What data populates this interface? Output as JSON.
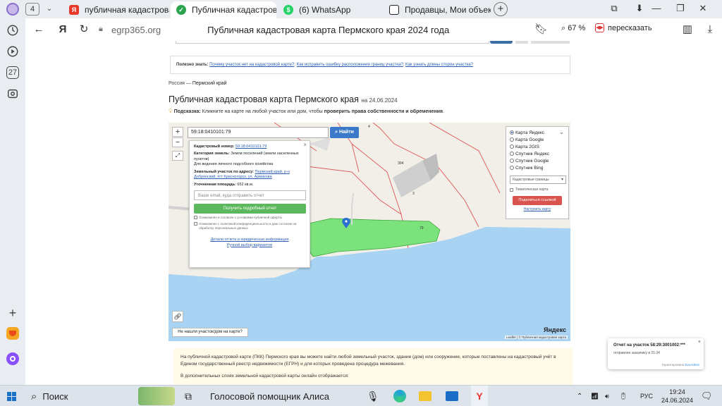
{
  "tabs": {
    "count": "4",
    "items": [
      {
        "title": "публичная кадастровая к",
        "fav_color": "#e8382a",
        "fav_glyph": "Я"
      },
      {
        "title": "Публичная кадастрова",
        "fav_color": "#2ca44e",
        "fav_glyph": "✓"
      },
      {
        "title": "(6) WhatsApp",
        "fav_color": "#25d366",
        "fav_glyph": "●"
      },
      {
        "title": "Продавцы, Мои объекты",
        "fav_color": "#222222",
        "fav_glyph": "▣"
      }
    ]
  },
  "sidebar": {
    "badge": "27"
  },
  "address": {
    "host": "egrp365.org",
    "title": "Публичная кадастровая карта Пермского края 2024 года",
    "zoom": "67 %",
    "retell": "пересказать"
  },
  "page": {
    "useful_label": "Полезно знать:",
    "useful_links": [
      "Почему участок нет на кадастровой карте?",
      "Как исправить ошибку расположения границ участка?",
      "Как узнать длины сторон участка?"
    ],
    "breadcrumb_root": "Россия",
    "breadcrumb_sep": "—",
    "breadcrumb_current": "Пермский край",
    "heading": "Публичная кадастровая карта Пермского края",
    "heading_date": "на 24.06.2024",
    "hint_label": "Подсказка:",
    "hint_text": "Кликните на карте на любой участок или дом, чтобы",
    "hint_bold": "проверить права собственности и обременения",
    "desc_1": "На публичной кадастровой карте (ПКК) Пермского края вы можете найти любой земельный участок, здание (дом) или сооружение, которые поставлены на кадастровый учёт в Едином государственный реестр недвижимости (ЕГРН) и для которых проведена процедура межевания.",
    "desc_2": "В дополнительных слоях земельной кадастровой карты онлайн отображается:"
  },
  "map": {
    "search_value": "59:18:0410101:79",
    "find_button": "Найти",
    "labels": {
      "l304": "304",
      "l4": "4",
      "l3": "3",
      "l79": "79"
    },
    "popup": {
      "cad_label": "Кадастровый номер:",
      "cad_value": "59:18:0410101:79",
      "cat_label": "Категория земель:",
      "cat_value": "Земли поселений (земли населенных пунктов)",
      "use_value": "Для ведения личного подсобного хозяйства",
      "addr_label": "Земельный участок по адресу:",
      "addr_value": "Пермский край, р-н Добрянский, пгт Красногорск, ул. Армакова",
      "area_label": "Уточненная площадь:",
      "area_value": "652 кв.м.",
      "email_placeholder": "Ваше email, куда отправить отчет",
      "report_button": "Получить подробный отчет",
      "check1": "Ознакомлен и согласен с условиями публичной оферты",
      "check2": "Ознакомлен с политикой конфиденциальности и даю согласие на обработку персональных данных",
      "link1": "Детали отчета и юридическая информация",
      "link2": "Ручной выбор вариантов"
    },
    "layers": [
      {
        "label": "Карта Яндекс",
        "on": true
      },
      {
        "label": "Карта Google",
        "on": false
      },
      {
        "label": "Карта 2GIS",
        "on": false
      },
      {
        "label": "Спутник Яндекс",
        "on": false
      },
      {
        "label": "Спутник Google",
        "on": false
      },
      {
        "label": "Спутник Bing",
        "on": false
      }
    ],
    "layer_select": "Кадастровые границы",
    "thematic": "Тематическая карта",
    "share_button": "Поделиться ссылкой",
    "setup_link": "Настроить карту",
    "not_found": "Не нашли участок/дом на карте?",
    "attribution": "Leaflet | © Публичная кадастровая карта",
    "yandex": "Яндекс"
  },
  "notification": {
    "title": "Отчет на участок 58:29:3001002:***",
    "subtitle": "отправлен заказчику в 21:34",
    "powered": "Гарантировано",
    "powered_brand": "EvoAdmin"
  },
  "taskbar": {
    "search": "Поиск",
    "assistant": "Голосовой помощник Алиса",
    "lang": "РУС",
    "time": "19:24",
    "date": "24.06.2024"
  }
}
